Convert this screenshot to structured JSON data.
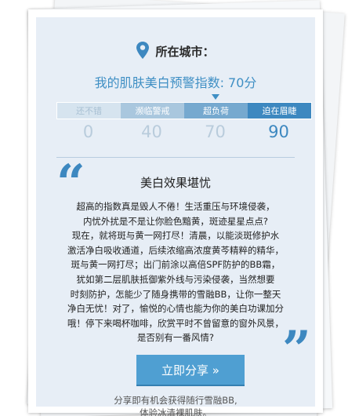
{
  "location": {
    "pin_icon": "map-pin-icon",
    "label": "所在城市："
  },
  "headline": "我的肌肤美白预警指数: 70分",
  "levels": [
    {
      "label": "还不错",
      "score": "0"
    },
    {
      "label": "濒临警戒",
      "score": "40"
    },
    {
      "label": "超负荷",
      "score": "70"
    },
    {
      "label": "迫在眉睫",
      "score": "90"
    }
  ],
  "result": {
    "title": "美白效果堪忧",
    "lines": [
      "超高的指数真是毁人不倦！生活重压与环境侵袭，",
      "内忧外扰是不是让你脸色黯黄，斑迹星星点点?",
      "现在，就将斑与黄一网打尽！清晨，以能淡斑修护水",
      "激活净白吸收通道，后续浓缩高浓度黄芩精粹的精华，",
      "斑与黄一网打尽；出门前涂以高倍SPF防护的BB霜，",
      "犹如第二层肌肤抵御紫外线与污染侵袭，当然想要",
      "时刻防护，怎能少了随身携带的雪融BB，让你一整天",
      "净白无忧！对了，愉悦的心情也能为你的美白功课加分",
      "哦！停下来喝杯咖啡，欣赏平时不曾留意的窗外风景，",
      "是否别有一番风情?"
    ]
  },
  "share_button": "立即分享 »",
  "footer": {
    "line1": "分享即有机会获得随行雪融BB,",
    "line2": "体验冰清裸肌肤。"
  },
  "colors": {
    "accent": "#3d88c0",
    "panel": "#e7eef6",
    "button": "#4f9fd2"
  }
}
